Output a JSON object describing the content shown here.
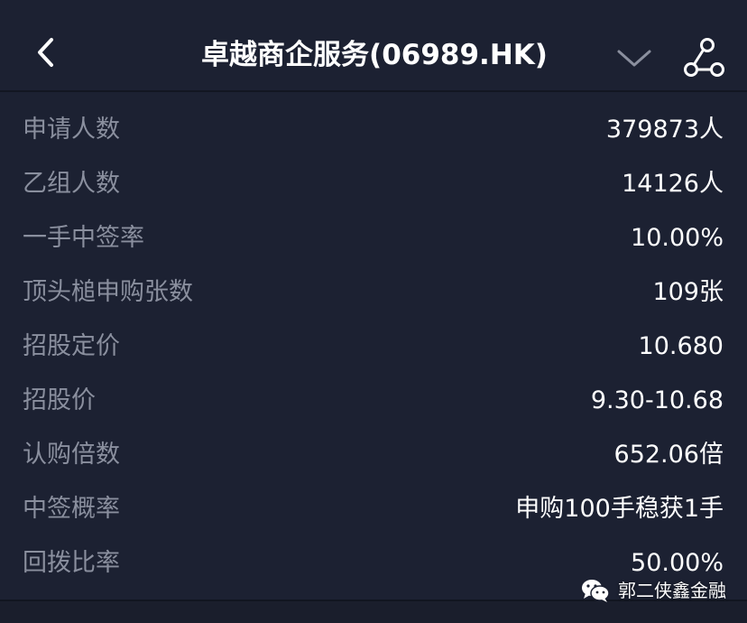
{
  "header": {
    "title": "卓越商企服务(06989.HK)",
    "back_icon": "chevron-left-icon",
    "dropdown_icon": "chevron-down-icon",
    "share_icon": "share-nodes-icon"
  },
  "rows": [
    {
      "label": "申请人数",
      "value": "379873人"
    },
    {
      "label": "乙组人数",
      "value": "14126人"
    },
    {
      "label": "一手中签率",
      "value": "10.00%"
    },
    {
      "label": "顶头槌申购张数",
      "value": "109张"
    },
    {
      "label": "招股定价",
      "value": "10.680"
    },
    {
      "label": "招股价",
      "value": "9.30-10.68"
    },
    {
      "label": "认购倍数",
      "value": "652.06倍"
    },
    {
      "label": "中签概率",
      "value": "申购100手稳获1手"
    },
    {
      "label": "回拨比率",
      "value": "50.00%"
    }
  ],
  "watermark": {
    "text": "郭二侠鑫金融",
    "icon": "wechat-icon"
  },
  "colors": {
    "background": "#1c2132",
    "label": "#8a8f9e",
    "value": "#ffffff"
  }
}
